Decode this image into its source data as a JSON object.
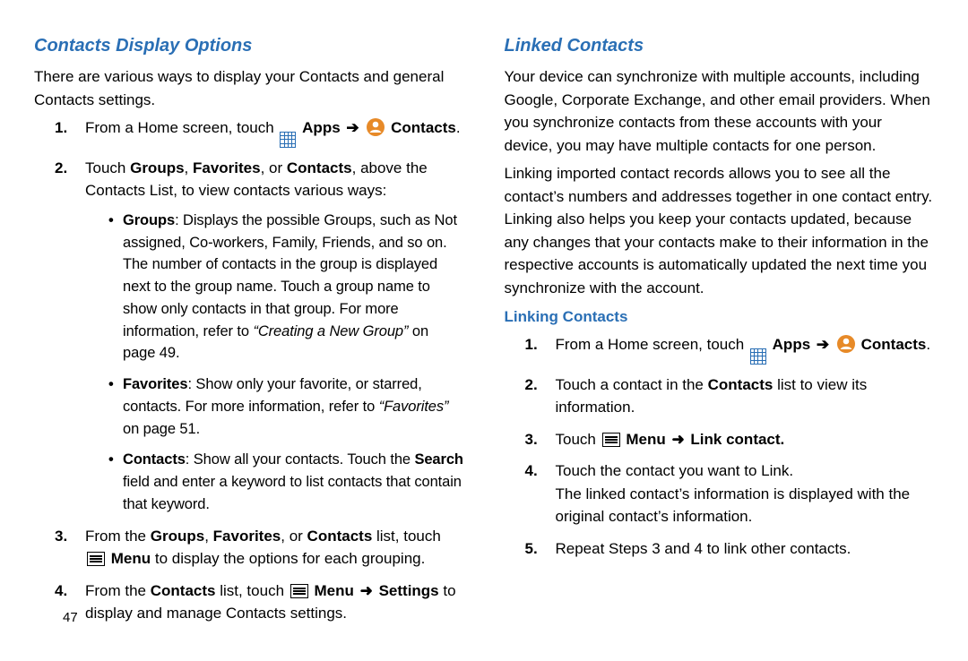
{
  "page_number": "47",
  "left": {
    "title": "Contacts Display Options",
    "intro": "There are various ways to display your Contacts and general Contacts settings.",
    "step1_pre": "From a Home screen, touch ",
    "apps_label": "Apps",
    "contacts_label": "Contacts",
    "step2_pre": "Touch ",
    "step2_b1": "Groups",
    "step2_m1": ", ",
    "step2_b2": "Favorites",
    "step2_m2": ", or ",
    "step2_b3": "Contacts",
    "step2_post": ", above the Contacts List, to view contacts various ways:",
    "bullet_groups_b": "Groups",
    "bullet_groups_t1": ": Displays the possible Groups, such as Not assigned, Co-workers, Family, Friends, and so on. The number of contacts in the group is displayed next to the group name. Touch a group name to show only contacts in that group. For more information, refer to ",
    "bullet_groups_ref": "“Creating a New Group”",
    "bullet_groups_t2": " on page 49.",
    "bullet_fav_b": "Favorites",
    "bullet_fav_t1": ": Show only your favorite, or starred, contacts. For more information, refer to ",
    "bullet_fav_ref": "“Favorites”",
    "bullet_fav_t2": " on page 51.",
    "bullet_con_b": "Contacts",
    "bullet_con_t1": ": Show all your contacts. Touch the ",
    "bullet_con_search": "Search",
    "bullet_con_t2": " field and enter a keyword to list contacts that contain that keyword.",
    "step3_pre": "From the ",
    "step3_b1": "Groups",
    "step3_m1": ", ",
    "step3_b2": "Favorites",
    "step3_m2": ", or ",
    "step3_b3": "Contacts",
    "step3_m3": " list, touch ",
    "step3_menu": "Menu",
    "step3_post": " to display the options for each grouping.",
    "step4_pre": "From the ",
    "step4_b1": "Contacts",
    "step4_m1": " list, touch ",
    "step4_menu": "Menu",
    "step4_arrow": " ➜ ",
    "step4_settings": "Settings",
    "step4_post": " to display and manage Contacts settings."
  },
  "right": {
    "title": "Linked Contacts",
    "p1": "Your device can synchronize with multiple accounts, including Google, Corporate Exchange, and other email providers. When you synchronize contacts from these accounts with your device, you may have multiple contacts for one person.",
    "p2": "Linking imported contact records allows you to see all the contact’s numbers and addresses together in one contact entry. Linking also helps you keep your contacts updated, because any changes that your contacts make to their information in the respective accounts is automatically updated the next time you synchronize with the account.",
    "subtitle": "Linking Contacts",
    "step1_pre": "From a Home screen, touch ",
    "apps_label": "Apps",
    "contacts_label": "Contacts",
    "step2_pre": "Touch a contact in the ",
    "step2_b": "Contacts",
    "step2_post": " list to view its information.",
    "step3_pre": "Touch ",
    "step3_menu": "Menu",
    "step3_arrow": " ➜ ",
    "step3_link": "Link contact",
    "step4": "Touch the contact you want to Link.",
    "step4b": "The linked contact’s information is displayed with the original contact’s information.",
    "step5": "Repeat Steps 3 and 4 to link other contacts."
  }
}
